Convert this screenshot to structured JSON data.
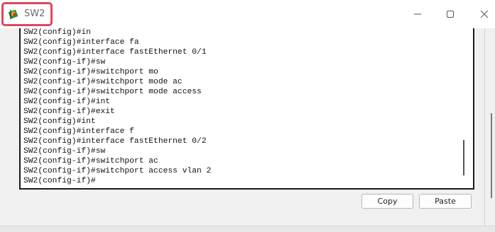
{
  "window": {
    "title": "SW2",
    "icons": {
      "app": "packet-tracer-switch-icon",
      "minimize": "minimize-icon",
      "maximize": "maximize-icon",
      "close": "close-icon"
    }
  },
  "terminal": {
    "lines": [
      "SW2(config)#in",
      "SW2(config)#interface fa",
      "SW2(config)#interface fastEthernet 0/1",
      "SW2(config-if)#sw",
      "SW2(config-if)#switchport mo",
      "SW2(config-if)#switchport mode ac",
      "SW2(config-if)#switchport mode access",
      "SW2(config-if)#int",
      "SW2(config-if)#exit",
      "SW2(config)#int",
      "SW2(config)#interface f",
      "SW2(config)#interface fastEthernet 0/2",
      "SW2(config-if)#sw",
      "SW2(config-if)#switchport ac",
      "SW2(config-if)#switchport access vlan 2",
      "SW2(config-if)#"
    ]
  },
  "buttons": {
    "copy": "Copy",
    "paste": "Paste"
  },
  "colors": {
    "highlight": "#e0475d",
    "terminal_bg": "#ffffff",
    "window_bg": "#f0f0f0"
  }
}
